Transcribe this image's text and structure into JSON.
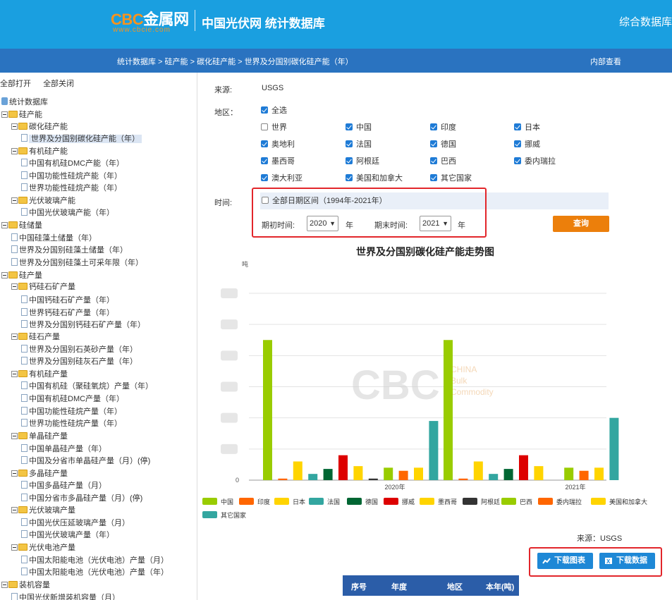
{
  "header": {
    "logo_cbc": "CBC",
    "logo_metal": "金属网",
    "logo_url": "www.cbcie.com",
    "site_title": "中国光伏网 统计数据库",
    "right_link": "综合数据库"
  },
  "breadcrumb": "统计数据库 > 硅产能 > 碳化硅产能 > 世界及分国别碳化硅产能（年）",
  "internal_link": "内部查看",
  "tree": {
    "expand_all": "全部打开",
    "collapse_all": "全部关闭",
    "nodes": [
      {
        "label": "统计数据库",
        "kind": "root"
      },
      {
        "label": "硅产能",
        "kind": "folder"
      },
      {
        "label": "碳化硅产能",
        "kind": "folder"
      },
      {
        "label": "世界及分国别碳化硅产能（年）",
        "kind": "file",
        "selected": true
      },
      {
        "label": "有机硅产能",
        "kind": "folder"
      },
      {
        "label": "中国有机硅DMC产能（年）",
        "kind": "file"
      },
      {
        "label": "中国功能性硅烷产能（年）",
        "kind": "file"
      },
      {
        "label": "世界功能性硅烷产能（年）",
        "kind": "file"
      },
      {
        "label": "光伏玻璃产能",
        "kind": "folder"
      },
      {
        "label": "中国光伏玻璃产能（年）",
        "kind": "file"
      },
      {
        "label": "硅储量",
        "kind": "folder"
      },
      {
        "label": "中国硅藻土储量（年）",
        "kind": "file"
      },
      {
        "label": "世界及分国别硅藻土储量（年）",
        "kind": "file"
      },
      {
        "label": "世界及分国别硅藻土可采年限（年）",
        "kind": "file"
      },
      {
        "label": "硅产量",
        "kind": "folder"
      },
      {
        "label": "钙硅石矿产量",
        "kind": "folder"
      },
      {
        "label": "中国钙硅石矿产量（年）",
        "kind": "file"
      },
      {
        "label": "世界钙硅石矿产量（年）",
        "kind": "file"
      },
      {
        "label": "世界及分国别钙硅石矿产量（年）",
        "kind": "file"
      },
      {
        "label": "硅石产量",
        "kind": "folder"
      },
      {
        "label": "世界及分国别石英砂产量（年）",
        "kind": "file"
      },
      {
        "label": "世界及分国别硅灰石产量（年）",
        "kind": "file"
      },
      {
        "label": "有机硅产量",
        "kind": "folder"
      },
      {
        "label": "中国有机硅（聚硅氧烷）产量（年）",
        "kind": "file"
      },
      {
        "label": "中国有机硅DMC产量（年）",
        "kind": "file"
      },
      {
        "label": "中国功能性硅烷产量（年）",
        "kind": "file"
      },
      {
        "label": "世界功能性硅烷产量（年）",
        "kind": "file"
      },
      {
        "label": "单晶硅产量",
        "kind": "folder"
      },
      {
        "label": "中国单晶硅产量（年）",
        "kind": "file"
      },
      {
        "label": "中国及分省市单晶硅产量（月）(停)",
        "kind": "file"
      },
      {
        "label": "多晶硅产量",
        "kind": "folder"
      },
      {
        "label": "中国多晶硅产量（月）",
        "kind": "file"
      },
      {
        "label": "中国分省市多晶硅产量（月）(停)",
        "kind": "file"
      },
      {
        "label": "光伏玻璃产量",
        "kind": "folder"
      },
      {
        "label": "中国光伏压延玻璃产量（月）",
        "kind": "file"
      },
      {
        "label": "中国光伏玻璃产量（年）",
        "kind": "file"
      },
      {
        "label": "光伏电池产量",
        "kind": "folder"
      },
      {
        "label": "中国太阳能电池（光伏电池）产量（月）",
        "kind": "file"
      },
      {
        "label": "中国太阳能电池（光伏电池）产量（年）",
        "kind": "file"
      },
      {
        "label": "装机容量",
        "kind": "folder"
      },
      {
        "label": "中国光伏新增装机容量（月）",
        "kind": "file"
      }
    ]
  },
  "filters": {
    "source_label": "来源:",
    "source_value": "USGS",
    "region_label": "地区：",
    "select_all": "全选",
    "regions": [
      {
        "name": "世界",
        "checked": false
      },
      {
        "name": "中国",
        "checked": true
      },
      {
        "name": "印度",
        "checked": true
      },
      {
        "name": "日本",
        "checked": true
      },
      {
        "name": "奥地利",
        "checked": true
      },
      {
        "name": "法国",
        "checked": true
      },
      {
        "name": "德国",
        "checked": true
      },
      {
        "name": "挪威",
        "checked": true
      },
      {
        "name": "墨西哥",
        "checked": true
      },
      {
        "name": "阿根廷",
        "checked": true
      },
      {
        "name": "巴西",
        "checked": true
      },
      {
        "name": "委内瑞拉",
        "checked": true
      },
      {
        "name": "澳大利亚",
        "checked": true
      },
      {
        "name": "美国和加拿大",
        "checked": true
      },
      {
        "name": "其它国家",
        "checked": true
      }
    ],
    "time_label": "时间:",
    "all_dates": "全部日期区间（1994年-2021年）",
    "start_label": "期初时间:",
    "start_value": "2020",
    "end_label": "期末时间:",
    "end_value": "2021",
    "year_unit": "年",
    "query_button": "查询"
  },
  "colors": {
    "header_bg": "#1a9fe0",
    "crumb_bg": "#2a73c0",
    "query_btn": "#ec7f0b",
    "download_btn": "#1e88d6",
    "highlight_border": "#e2262b"
  },
  "chart_data": {
    "type": "bar",
    "title": "世界及分国别碳化硅产能走势图",
    "ylabel": "吨",
    "categories": [
      "2020年",
      "2021年"
    ],
    "ylim": [
      0,
      600000
    ],
    "series": [
      {
        "name": "中国",
        "color": "#99cc00",
        "values": [
          450000,
          450000
        ]
      },
      {
        "name": "印度",
        "color": "#ff6600",
        "values": [
          5000,
          5000
        ]
      },
      {
        "name": "日本",
        "color": "#ffd400",
        "values": [
          60000,
          60000
        ]
      },
      {
        "name": "法国",
        "color": "#33a6a0",
        "values": [
          20000,
          20000
        ]
      },
      {
        "name": "德国",
        "color": "#006633",
        "values": [
          36000,
          36000
        ]
      },
      {
        "name": "挪威",
        "color": "#dd0000",
        "values": [
          80000,
          80000
        ]
      },
      {
        "name": "墨西哥",
        "color": "#ffd400",
        "values": [
          45000,
          45000
        ]
      },
      {
        "name": "阿根廷",
        "color": "#333333",
        "values": [
          5000,
          0
        ]
      },
      {
        "name": "巴西",
        "color": "#99cc00",
        "values": [
          40000,
          40000
        ]
      },
      {
        "name": "委内瑞拉",
        "color": "#ff6600",
        "values": [
          30000,
          30000
        ]
      },
      {
        "name": "美国和加拿大",
        "color": "#ffd400",
        "values": [
          40000,
          40000
        ]
      },
      {
        "name": "其它国家",
        "color": "#33a6a0",
        "values": [
          190000,
          200000
        ]
      }
    ],
    "watermark": {
      "big": "CBC",
      "lines": [
        "CHINA",
        "Bulk",
        "Commodity"
      ]
    }
  },
  "bottom": {
    "source_line": "来源：USGS",
    "download_chart": "下载图表",
    "download_data": "下载数据"
  },
  "table": {
    "headers": [
      "序号",
      "年度",
      "地区",
      "本年(吨)"
    ]
  }
}
